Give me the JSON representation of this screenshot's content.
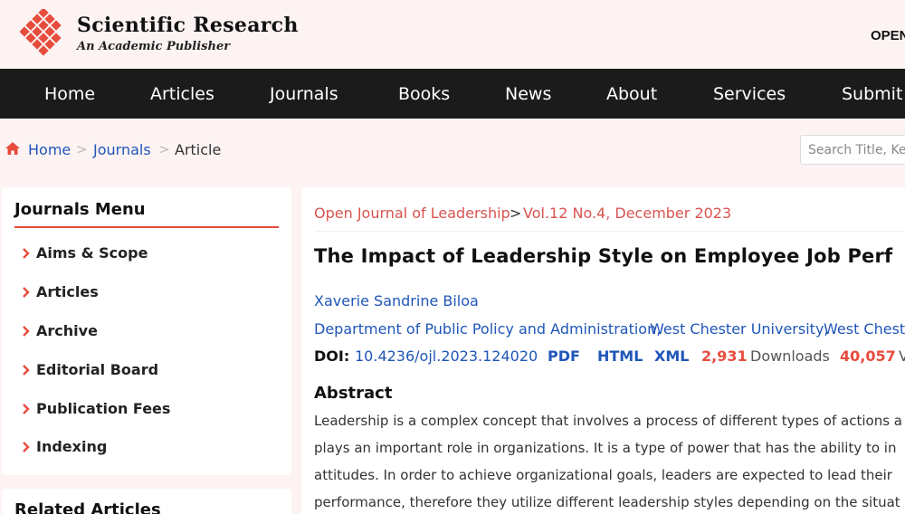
{
  "header": {
    "brand_title": "Scientific Research",
    "brand_subtitle": "An Academic Publisher",
    "open_label": "OPEN",
    "brand_color": "#e74c3c"
  },
  "nav": {
    "items": [
      "Home",
      "Articles",
      "Journals",
      "Books",
      "News",
      "About",
      "Services",
      "Submit"
    ]
  },
  "breadcrumb": {
    "home": "Home",
    "journals": "Journals",
    "current": "Article",
    "separator": ">"
  },
  "search": {
    "placeholder": "Search Title, Ke"
  },
  "journals_menu": {
    "title": "Journals Menu",
    "items": [
      "Aims & Scope",
      "Articles",
      "Archive",
      "Editorial Board",
      "Publication Fees",
      "Indexing"
    ]
  },
  "related": {
    "title": "Related Articles"
  },
  "article": {
    "journal": "Open Journal of Leadership",
    "issue_separator": ">",
    "issue": "Vol.12 No.4, December 2023",
    "title": "The Impact of Leadership Style on Employee Job Perf",
    "author": "Xaverie Sandrine Biloa",
    "affiliation": [
      "Department of Public Policy and Administration,",
      "West Chester University,",
      "West Cheste"
    ],
    "doi_label": "DOI:",
    "doi": "10.4236/ojl.2023.124020",
    "formats": [
      "PDF",
      "HTML",
      "XML"
    ],
    "downloads_count": "2,931",
    "downloads_label": "Downloads",
    "views_count": "40,057",
    "views_label": "V"
  },
  "abstract": {
    "title": "Abstract",
    "lines": [
      "Leadership is a complex concept that involves a process of different types of actions a",
      "plays an important role in organizations. It is a type of power that has the ability to in",
      "attitudes. In order to achieve organizational goals, leaders are expected to lead their",
      "performance, therefore they utilize different leadership styles depending on the situat"
    ]
  },
  "colors": {
    "accent_red": "#e74c3c",
    "link_blue": "#1f56b8",
    "nav_bg": "#1b1b1b",
    "page_bg": "#fdf3f3"
  }
}
